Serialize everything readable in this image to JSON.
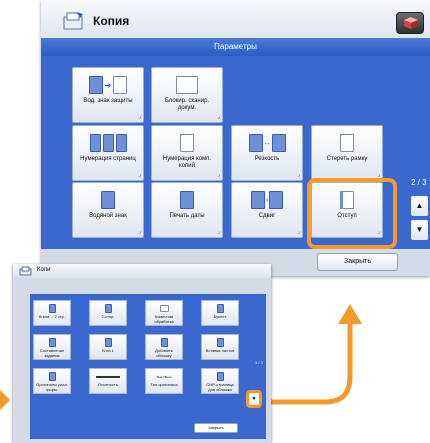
{
  "main": {
    "title": "Копия",
    "section": "Параметры",
    "tiles": [
      {
        "label": "Вод. знак защиты"
      },
      {
        "label": "Блокир. сканир. докум."
      },
      {
        "label": "Нумерация страниц"
      },
      {
        "label": "Нумерация комп. копий"
      },
      {
        "label": "Резкость"
      },
      {
        "label": "Стереть рамку"
      },
      {
        "label": "Водяной знак"
      },
      {
        "label": "Печать даты"
      },
      {
        "label": "Сдвиг"
      },
      {
        "label": "Отступ"
      }
    ],
    "page": "2 / 3",
    "close": "Закрыть"
  },
  "mini": {
    "title": "Копи",
    "tiles": [
      {
        "label": "Книга→ 2 стр."
      },
      {
        "label": "2-стор."
      },
      {
        "label": "Комичная обработка"
      },
      {
        "label": "Буклет"
      },
      {
        "label": "Составление задания"
      },
      {
        "label": "N на 1"
      },
      {
        "label": "Добавить обложку"
      },
      {
        "label": "Вставка листов"
      },
      {
        "label": "Оригиналы разл. форм."
      },
      {
        "label": "Плотность"
      },
      {
        "label": "Тип оригинала"
      },
      {
        "label": "ОНР-страница для обложки"
      }
    ],
    "page": "1 / 3",
    "close": "Закрыть",
    "extra_label": "Текст/Фото"
  },
  "colors": {
    "accent": "#3a68cf",
    "highlight": "#f39a2a"
  }
}
